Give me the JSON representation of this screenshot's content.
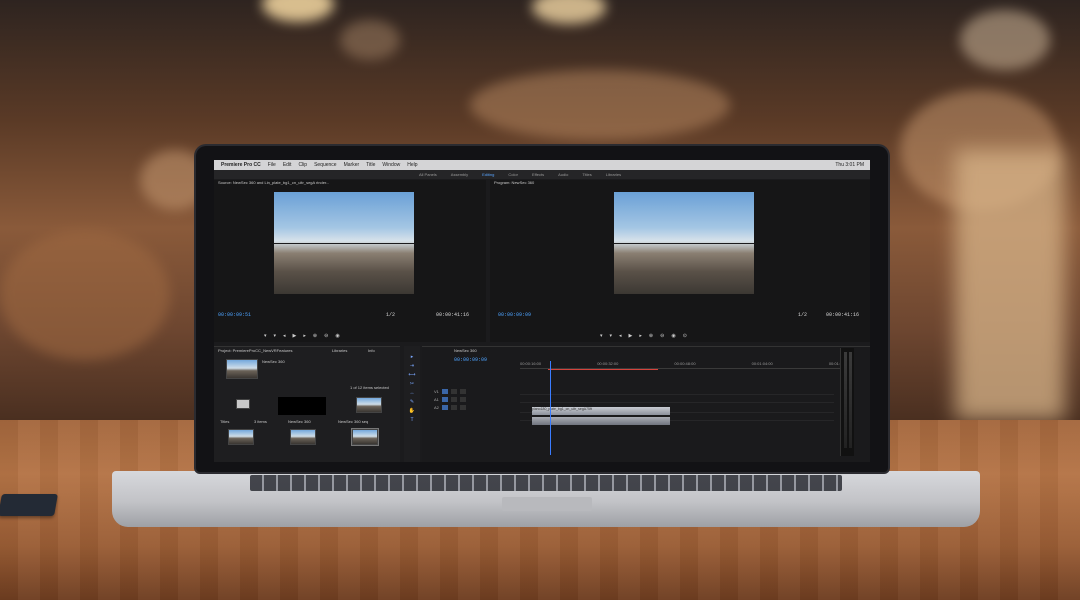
{
  "app": {
    "name": "Premiere Pro CC",
    "menus": [
      "File",
      "Edit",
      "Clip",
      "Sequence",
      "Marker",
      "Title",
      "Window",
      "Help"
    ],
    "clock": "Thu 3:01 PM"
  },
  "workspaces": [
    "All Panels",
    "Assembly",
    "Editing",
    "Color",
    "Effects",
    "Audio",
    "Titles",
    "Libraries"
  ],
  "source_monitor": {
    "tab": "Source: NewSec 360 and Lin_plate_bg1_cn_ultr_segA rinder...",
    "timecode_in": "00:00:09:51",
    "timecode_out": "00:00:41:16",
    "zoom": "1/2"
  },
  "program_monitor": {
    "tab": "Program: NewSec 360",
    "timecode_in": "00:00:09:09",
    "timecode_out": "00:00:41:16",
    "zoom": "1/2"
  },
  "project_panel": {
    "tab": "Project: PremiereProCC_NewVRFeatures",
    "other_tabs": [
      "Libraries",
      "Info"
    ],
    "sequence_name": "NewSec 360",
    "items_count": "1 of 12 items selected",
    "search_placeholder": "",
    "items": [
      {
        "label": "Titles"
      },
      {
        "label": "3 items"
      },
      {
        "label": "NewSec 360"
      },
      {
        "label": "NewSec 360 seq"
      }
    ]
  },
  "timeline": {
    "tab": "NewSec 360",
    "timecode": "00:00:09:09",
    "ruler": [
      "00:00:16:00",
      "00:00:32:00",
      "00:00:48:00",
      "00:01:04:00",
      "00:01:20:00"
    ],
    "tracks": [
      "V1",
      "A1",
      "A2"
    ],
    "clip_label": "piano180_plate_bg1_cn_ultr_segA75ft"
  }
}
